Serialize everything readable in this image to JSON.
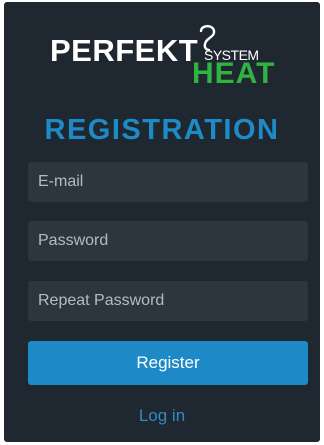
{
  "logo": {
    "word_main": "PERFEKT",
    "word_system": "SYSTEM",
    "word_heat": "HEAT",
    "colors": {
      "main": "#ffffff",
      "heat": "#2fb441"
    }
  },
  "form": {
    "title": "REGISTRATION",
    "email": {
      "value": "",
      "placeholder": "E-mail"
    },
    "password": {
      "value": "",
      "placeholder": "Password"
    },
    "repeat_password": {
      "value": "",
      "placeholder": "Repeat Password"
    },
    "register_label": "Register",
    "login_label": "Log in"
  },
  "colors": {
    "background": "#1f2730",
    "field": "#2d353e",
    "accent": "#1d8ac7"
  }
}
